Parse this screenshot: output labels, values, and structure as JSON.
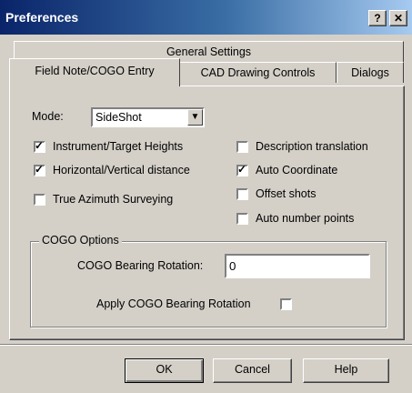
{
  "window": {
    "title": "Preferences",
    "help_glyph": "?",
    "close_glyph": "✕"
  },
  "tabs": {
    "row2": [
      "General Settings"
    ],
    "row1": [
      "Field Note/COGO Entry",
      "CAD Drawing Controls",
      "Dialogs"
    ],
    "active": "Field Note/COGO Entry"
  },
  "mode": {
    "label": "Mode:",
    "value": "SideShot",
    "arrow_icon": "▼"
  },
  "checkboxes_left": [
    {
      "label": "Instrument/Target Heights",
      "checked": true
    },
    {
      "label": "Horizontal/Vertical distance",
      "checked": true
    },
    {
      "label": "True Azimuth Surveying",
      "checked": false
    }
  ],
  "checkboxes_right": [
    {
      "label": "Description translation",
      "checked": false
    },
    {
      "label": "Auto Coordinate",
      "checked": true
    },
    {
      "label": "Offset shots",
      "checked": false
    },
    {
      "label": "Auto number points",
      "checked": false
    }
  ],
  "cogo": {
    "group_title": "COGO Options",
    "rotation_label": "COGO Bearing Rotation:",
    "rotation_value": "0",
    "apply_label": "Apply COGO Bearing Rotation",
    "apply_checked": false
  },
  "buttons": {
    "ok": "OK",
    "cancel": "Cancel",
    "help": "Help"
  }
}
